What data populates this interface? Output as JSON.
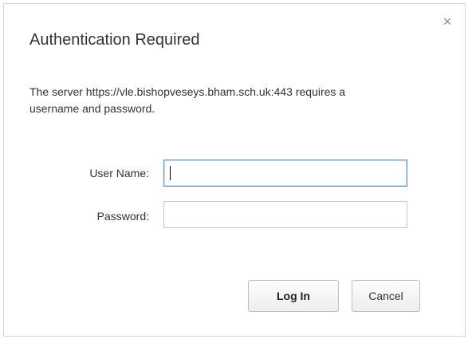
{
  "dialog": {
    "title": "Authentication Required",
    "message": "The server https://vle.bishopveseys.bham.sch.uk:443 requires a username and password.",
    "close_icon": "close-icon",
    "fields": {
      "username_label": "User Name:",
      "username_value": "",
      "password_label": "Password:",
      "password_value": ""
    },
    "buttons": {
      "login_label": "Log In",
      "cancel_label": "Cancel"
    }
  }
}
